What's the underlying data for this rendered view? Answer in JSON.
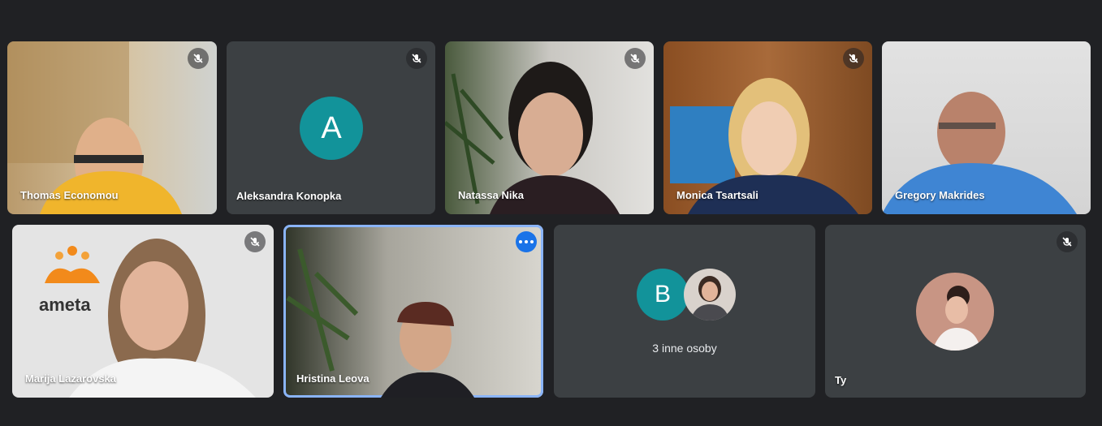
{
  "participants": [
    {
      "name": "Thomas Economou",
      "muted": true
    },
    {
      "name": "Aleksandra Konopka",
      "muted": true,
      "avatar_letter": "A"
    },
    {
      "name": "Natassa Nika",
      "muted": true
    },
    {
      "name": "Monica Tsartsali",
      "muted": true
    },
    {
      "name": "Gregory Makrides",
      "muted": false
    },
    {
      "name": "Marija Lazarovska",
      "muted": true,
      "logo_text": "ameta"
    },
    {
      "name": "Hristina Leova",
      "muted": false,
      "active": true
    },
    {
      "group_avatar_letter": "B",
      "group_label": "3 inne osoby"
    },
    {
      "name": "Ty",
      "muted": true
    }
  ],
  "colors": {
    "background": "#202124",
    "tile": "#3c4043",
    "avatar_teal": "#12939a",
    "active_border": "#8ab4f8",
    "more_button": "#1a73e8"
  },
  "icons": {
    "mic_off": "mic-off-icon",
    "more": "more-options-icon"
  }
}
